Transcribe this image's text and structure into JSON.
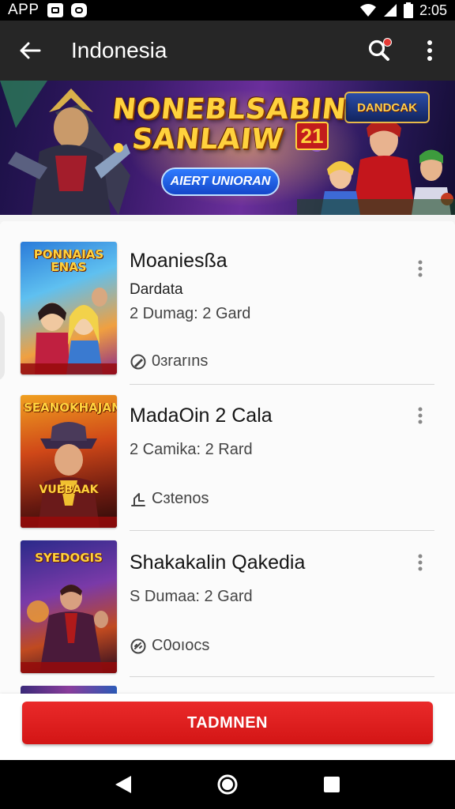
{
  "status_bar": {
    "app_label": "APP",
    "time": "2:05",
    "icons": [
      "image-icon",
      "chat-icon",
      "wifi-icon",
      "signal-icon",
      "battery-icon"
    ]
  },
  "app_bar": {
    "title": "Indonesia",
    "icons": [
      "back-arrow-icon",
      "search-icon",
      "more-vertical-icon"
    ],
    "notification_color": "#e53935"
  },
  "banner": {
    "title": "NONEBLSABIN SANLAIW",
    "badge": "21",
    "button_label": "AIERT UNIORAN",
    "logo_text": "DANDCAK"
  },
  "items": [
    {
      "thumb_title": "PONNAIAS ENAS",
      "name": "Moaniesßa",
      "subtitle": "Dardata",
      "meta": "2 Dumag: 2 Gard",
      "footer": "0ɜrarıns",
      "footer_icon": "edit-link-icon"
    },
    {
      "thumb_title": "SEANOKHAJAN",
      "thumb_title_bottom": "VUEBAAK",
      "name": "MadaOin 2 Cala",
      "subtitle": "",
      "meta": "2 Camika: 2 Rard",
      "footer": "Cɜtenos",
      "footer_icon": "share-hand-icon"
    },
    {
      "thumb_title": "SYEDOGIS",
      "name": "Shakakalin Qakedia",
      "subtitle": "",
      "meta": "S Dumaa: 2 Gard",
      "footer": "C0oıocs",
      "footer_icon": "link-circle-icon"
    }
  ],
  "cta": {
    "label": "TADMNEN",
    "color": "#e21f1f"
  },
  "nav_bar": {
    "icons": [
      "back-triangle-icon",
      "home-circle-icon",
      "recents-square-icon"
    ]
  }
}
